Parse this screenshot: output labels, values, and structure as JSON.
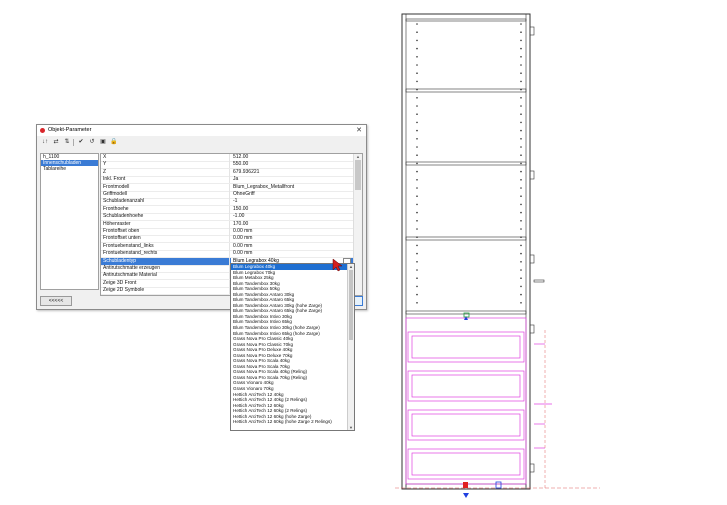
{
  "dialog": {
    "title": "Objekt-Parameter",
    "close_glyph": "✕",
    "toolbar": [
      {
        "icon": "sort-icon",
        "glyph": "↓↑"
      },
      {
        "icon": "swap-icon",
        "glyph": "⇄"
      },
      {
        "icon": "filter-icon",
        "glyph": "⇅"
      },
      {
        "icon": "check-icon",
        "glyph": "✔"
      },
      {
        "icon": "undo-icon",
        "glyph": "↺"
      },
      {
        "icon": "image-icon",
        "glyph": "▣"
      },
      {
        "icon": "lock-icon",
        "glyph": "🔒"
      }
    ],
    "tree": [
      "h_1100",
      "Innenschubladen",
      "Tablareihe"
    ],
    "tree_selected": 1,
    "properties": [
      {
        "key": "X",
        "value": "512.00"
      },
      {
        "key": "Y",
        "value": "550.00"
      },
      {
        "key": "Z",
        "value": "679.936221"
      },
      {
        "key": "Inkl. Front",
        "value": "Ja"
      },
      {
        "key": "Frontmodell",
        "value": "Blum_Legrabox_Metallfront"
      },
      {
        "key": "Griffmodell",
        "value": "OhneGriff"
      },
      {
        "key": "Schubladenanzahl",
        "value": "-1"
      },
      {
        "key": "Fronthoehe",
        "value": "150.00"
      },
      {
        "key": "Schubladenhoehe",
        "value": "-1.00"
      },
      {
        "key": "Höhenraster",
        "value": "170.00"
      },
      {
        "key": "Frontoffset oben",
        "value": "0.00 mm"
      },
      {
        "key": "Frontoffset unten",
        "value": "0.00 mm"
      },
      {
        "key": "Frontuebenstand_links",
        "value": "0.00 mm"
      },
      {
        "key": "Frontuebenstand_rechts",
        "value": "0.00 mm"
      },
      {
        "key": "Schubladentyp",
        "value": "Blum Legrabox 40kg"
      },
      {
        "key": "Antirutschmatte erzeugen",
        "value": ""
      },
      {
        "key": "Antirutschmatte Material",
        "value": ""
      },
      {
        "key": "Zeige 3D Front",
        "value": ""
      },
      {
        "key": "Zeige 2D Symbole",
        "value": ""
      }
    ],
    "selected_property": 14,
    "back_button": "<<<<<",
    "dropdown_arrow": "▾"
  },
  "dropdown": {
    "selected_index": 0,
    "items": [
      "Blum Legrabox 40kg",
      "Blum Legrabox 70kg",
      "Blum Metabox 25kg",
      "Blum Tandembox 30kg",
      "Blum Tandembox 50kg",
      "Blum Tandembox Antaro 30kg",
      "Blum Tandembox Antaro 65kg",
      "Blum Tandembox Antaro 30kg (hohe Zarge)",
      "Blum Tandembox Antaro 65kg (hohe Zarge)",
      "Blum Tandembox Intivo 30kg",
      "Blum Tandembox Intivo 65kg",
      "Blum Tandembox Intivo 30kg (hohe Zarge)",
      "Blum Tandembox Intivo 65kg (hohe Zarge)",
      "Grass Nova Pro Classic 40kg",
      "Grass Nova Pro Classic 70kg",
      "Grass Nova Pro Deluxe 40kg",
      "Grass Nova Pro Deluxe 70kg",
      "Grass Nova Pro Scala 40kg",
      "Grass Nova Pro Scala 70kg",
      "Grass Nova Pro Scala 40kg (Reling)",
      "Grass Nova Pro Scala 70kg (Reling)",
      "Grass Vionaro 40kg",
      "Grass Vionaro 70kg",
      "Hettich ArciTech 12 40kg",
      "Hettich ArciTech 12 40kg (2 Relings)",
      "Hettich ArciTech 12 60kg",
      "Hettich ArciTech 12 60kg (2 Relings)",
      "Hettich ArciTech 12 60kg (hohe Zarge)",
      "Hettich ArciTech 12 60kg (hohe Zarge 2 Relings)"
    ]
  },
  "colors": {
    "selection": "#3a7bd5",
    "drawer_outline": "#e040e0",
    "handle_red": "#e02020",
    "marker_blue": "#2040e0",
    "marker_green": "#20a040"
  }
}
